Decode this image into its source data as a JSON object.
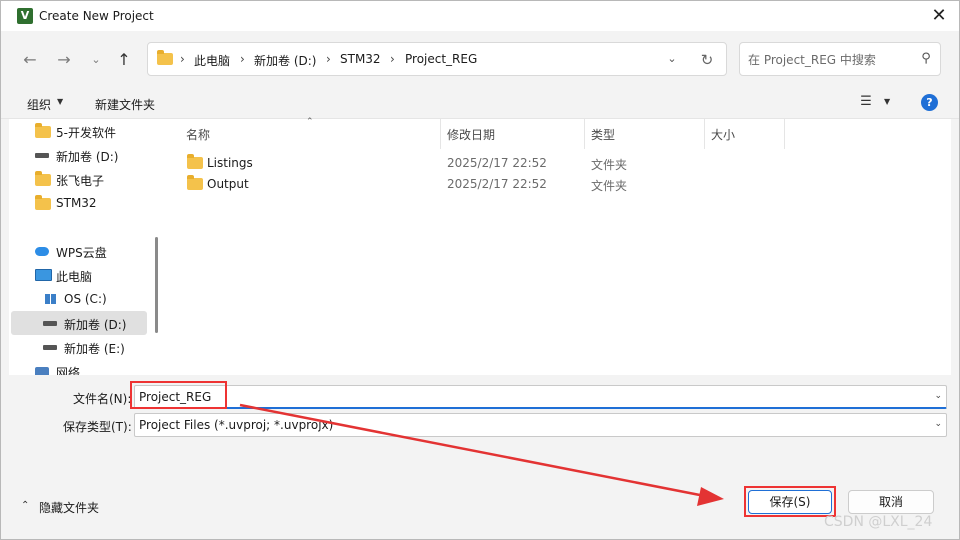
{
  "window": {
    "title": "Create New Project",
    "app_icon_letter": "V"
  },
  "nav": {
    "breadcrumb": [
      "此电脑",
      "新加卷 (D:)",
      "STM32",
      "Project_REG"
    ],
    "search_placeholder": "在 Project_REG 中搜索"
  },
  "toolbar": {
    "organize": "组织",
    "new_folder": "新建文件夹"
  },
  "sidebar": {
    "items": [
      {
        "label": "5-开发软件",
        "icon": "folder-icon"
      },
      {
        "label": "新加卷 (D:)",
        "icon": "drive-icon"
      },
      {
        "label": "张飞电子",
        "icon": "folder-icon"
      },
      {
        "label": "STM32",
        "icon": "folder-icon"
      },
      {
        "label": "WPS云盘",
        "icon": "cloud-icon"
      },
      {
        "label": "此电脑",
        "icon": "pc-icon"
      },
      {
        "label": "OS (C:)",
        "icon": "os-drive-icon"
      },
      {
        "label": "新加卷 (D:)",
        "icon": "drive-icon",
        "selected": true
      },
      {
        "label": "新加卷 (E:)",
        "icon": "drive-icon"
      },
      {
        "label": "网络",
        "icon": "network-icon"
      }
    ]
  },
  "files": {
    "columns": [
      "名称",
      "修改日期",
      "类型",
      "大小"
    ],
    "rows": [
      {
        "name": "Listings",
        "date": "2025/2/17 22:52",
        "type": "文件夹"
      },
      {
        "name": "Output",
        "date": "2025/2/17 22:52",
        "type": "文件夹"
      }
    ]
  },
  "form": {
    "filename_label": "文件名(N):",
    "filename_value": "Project_REG",
    "filetype_label": "保存类型(T):",
    "filetype_value": "Project Files (*.uvproj; *.uvprojx)"
  },
  "footer": {
    "hide_folders": "隐藏文件夹",
    "save": "保存(S)",
    "cancel": "取消"
  },
  "watermark": "CSDN @LXL_24",
  "colors": {
    "accent": "#1f6fd6",
    "highlight": "#e33333",
    "folder": "#f4c24b"
  }
}
